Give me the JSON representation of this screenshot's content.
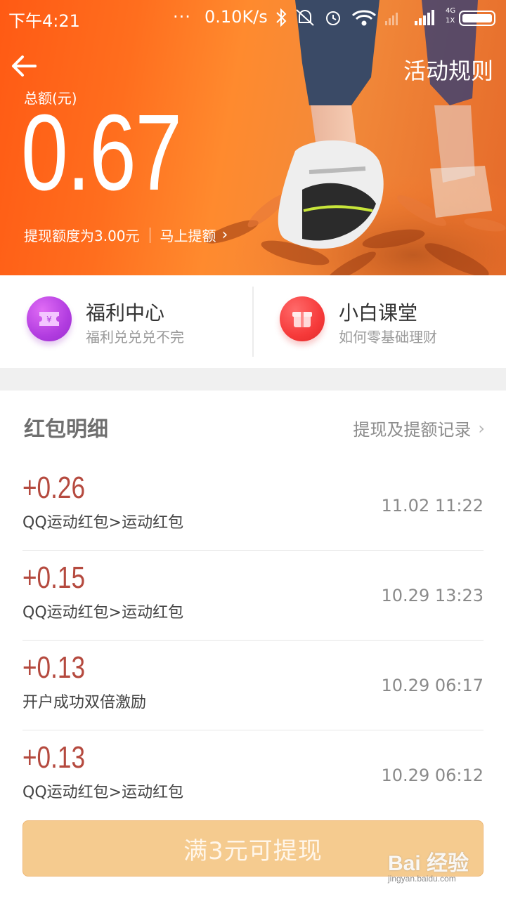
{
  "status_bar": {
    "time": "下午4:21",
    "dots": "···",
    "speed": "0.10K/s",
    "network": "4G",
    "sim": "1X"
  },
  "header": {
    "rules_label": "活动规则",
    "total_label": "总额(元)",
    "total_amount": "0.67",
    "withdraw_limit": "提现额度为3.00元",
    "raise_label": "马上提额"
  },
  "shortcuts": [
    {
      "title": "福利中心",
      "subtitle": "福利兑兑兑不完",
      "icon": "ticket-icon",
      "color": "#b23de0"
    },
    {
      "title": "小白课堂",
      "subtitle": "如何零基础理财",
      "icon": "gift-box-icon",
      "color": "#f63a3a"
    }
  ],
  "list": {
    "title": "红包明细",
    "records_link": "提现及提额记录",
    "records": [
      {
        "amount": "+0.26",
        "description": "QQ运动红包>运动红包",
        "time": "11.02 11:22"
      },
      {
        "amount": "+0.15",
        "description": "QQ运动红包>运动红包",
        "time": "10.29 13:23"
      },
      {
        "amount": "+0.13",
        "description": "开户成功双倍激励",
        "time": "10.29 06:17"
      },
      {
        "amount": "+0.13",
        "description": "QQ运动红包>运动红包",
        "time": "10.29 06:12"
      }
    ]
  },
  "withdraw_button": "满3元可提现",
  "watermark": {
    "text": "Bai 经验",
    "url": "jingyan.baidu.com"
  },
  "colors": {
    "hero_orange": "#ff6e1e",
    "amount_red": "#b54a3f",
    "button_disabled": "#f5cb8f"
  }
}
